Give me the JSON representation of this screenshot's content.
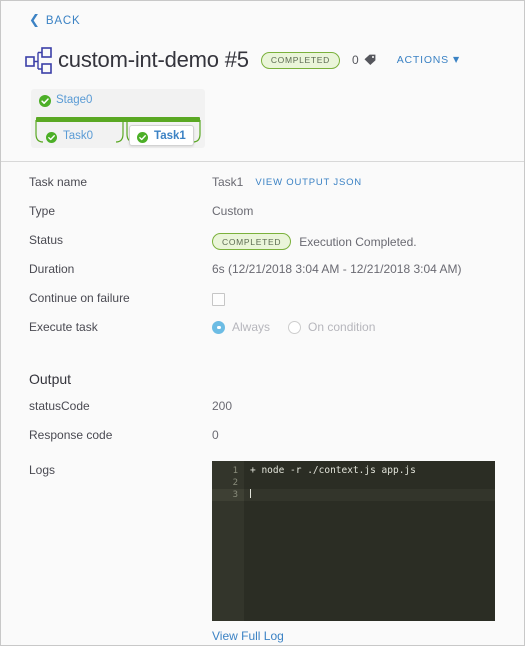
{
  "nav": {
    "back_label": "BACK",
    "back_icon": "chevron-left-icon"
  },
  "header": {
    "pipeline_icon": "pipeline-hierarchy-icon",
    "title": "custom-int-demo #5",
    "status_badge": "COMPLETED",
    "tag_count": "0",
    "tag_icon": "tag-icon",
    "actions_label": "ACTIONS",
    "actions_caret_icon": "chevron-down-icon"
  },
  "graph": {
    "stage": {
      "name": "Stage0",
      "status_icon": "check-circle-icon"
    },
    "tasks": [
      {
        "name": "Task0",
        "status_icon": "check-circle-icon",
        "selected": false
      },
      {
        "name": "Task1",
        "status_icon": "check-circle-icon",
        "selected": true
      }
    ]
  },
  "details": {
    "rows": [
      {
        "label": "Task name",
        "value": "Task1",
        "action": "VIEW OUTPUT JSON"
      },
      {
        "label": "Type",
        "value": "Custom"
      },
      {
        "label": "Status",
        "badge": "COMPLETED",
        "value": "Execution Completed."
      },
      {
        "label": "Duration",
        "value": "6s (12/21/2018 3:04 AM - 12/21/2018 3:04 AM)"
      },
      {
        "label": "Continue on failure",
        "checked": false
      },
      {
        "label": "Execute task"
      }
    ],
    "execute_task": {
      "options": [
        {
          "label": "Always",
          "selected": true
        },
        {
          "label": "On condition",
          "selected": false
        }
      ]
    }
  },
  "output": {
    "title": "Output",
    "rows": [
      {
        "label": "statusCode",
        "value": "200"
      },
      {
        "label": "Response code",
        "value": "0"
      }
    ],
    "logs_label": "Logs",
    "console_lines": [
      {
        "no": "1",
        "text": "+ node -r ./context.js app.js"
      },
      {
        "no": "2",
        "text": ""
      },
      {
        "no": "3",
        "text": ""
      }
    ],
    "view_full_log": "View Full Log"
  },
  "colors": {
    "accent_link": "#3b82c4",
    "status_green": "#5aa823",
    "badge_bg": "#eaf5d9",
    "badge_border": "#7bb13c",
    "radio_on": "#6cbce4",
    "console_bg": "#2b2d24",
    "console_gutter": "#33352b"
  }
}
